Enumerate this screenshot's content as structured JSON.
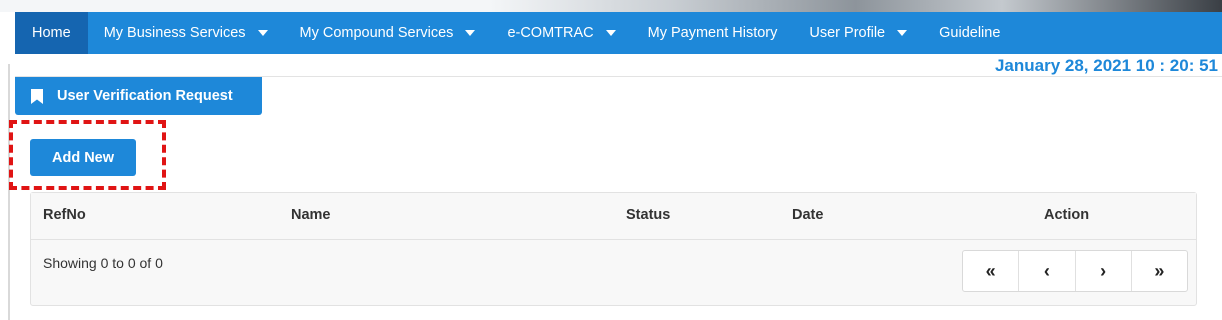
{
  "nav": {
    "items": [
      {
        "label": "Home",
        "active": true,
        "dropdown": false
      },
      {
        "label": "My Business Services",
        "dropdown": true
      },
      {
        "label": "My Compound Services",
        "dropdown": true
      },
      {
        "label": "e-COMTRAC",
        "dropdown": true
      },
      {
        "label": "My Payment History",
        "dropdown": false
      },
      {
        "label": "User Profile",
        "dropdown": true
      },
      {
        "label": "Guideline",
        "dropdown": false
      }
    ]
  },
  "datetime": "January 28, 2021 10 : 20: 51",
  "panel": {
    "title": "User Verification Request",
    "icon": "bookmark-icon"
  },
  "actions": {
    "add_new_label": "Add New"
  },
  "table": {
    "columns": [
      "RefNo",
      "Name",
      "Status",
      "Date",
      "Action"
    ],
    "rows": [],
    "info": "Showing 0 to 0 of 0"
  },
  "pagination": {
    "first": "«",
    "prev": "‹",
    "next": "›",
    "last": "»"
  },
  "colors": {
    "primary": "#1e88d9",
    "nav_active": "#1565b0",
    "highlight": "#e01414"
  }
}
